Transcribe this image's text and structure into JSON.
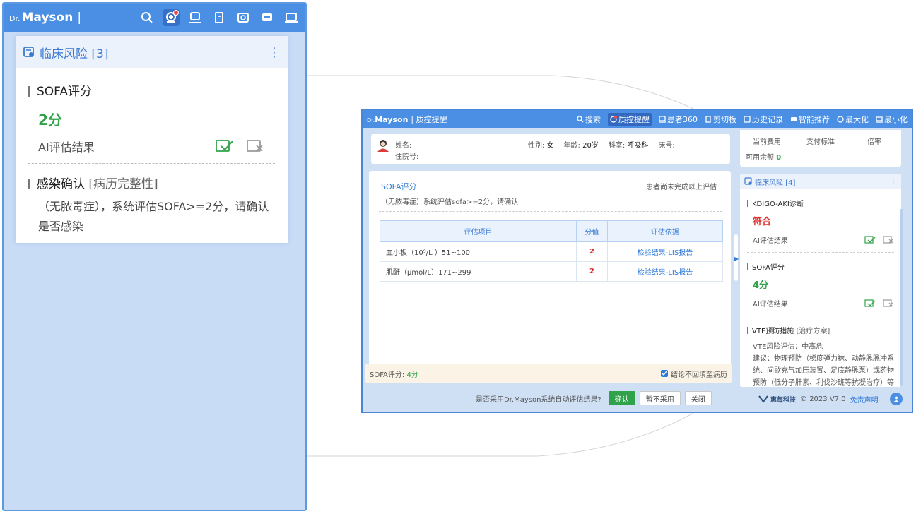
{
  "left_panel": {
    "brand_prefix": "Dr.",
    "brand_name": "Mayson",
    "brand_sep": "|",
    "card": {
      "title": "临床风险 [3]",
      "items": [
        {
          "title": "SOFA评分",
          "score": "2分",
          "ai_label": "AI评估结果"
        },
        {
          "title": "感染确认",
          "tag": "[病历完整性]",
          "desc": "（无脓毒症），系统评估SOFA>=2分，请确认是否感染"
        }
      ]
    }
  },
  "window": {
    "brand_prefix": "Dr.",
    "brand_name": "Mayson",
    "title": "| 质控提醒",
    "nav": [
      "搜索",
      "质控提醒",
      "患者360",
      "剪切板",
      "历史记录",
      "智能推荐",
      "最大化",
      "最小化"
    ],
    "patient": {
      "name_label": "姓名:",
      "gender_label": "性别:",
      "gender": "女",
      "age_label": "年龄:",
      "age": "20岁",
      "dept_label": "科室:",
      "dept": "呼吸科",
      "bed_label": "床号:",
      "admission_label": "住院号:"
    },
    "main": {
      "title": "SOFA评分",
      "status": "患者尚未完成以上评估",
      "desc": "（无脓毒症）系统评估sofa>=2分，请确认",
      "table": {
        "headers": [
          "评估项目",
          "分值",
          "评估依据"
        ],
        "rows": [
          {
            "item": "血小板（10⁹/L ）51~100",
            "score": "2",
            "basis": "检验结果-LIS报告"
          },
          {
            "item": "肌酐（μmol/L）171~299",
            "score": "2",
            "basis": "检验结果-LIS报告"
          }
        ]
      },
      "summary_label": "SOFA评分:",
      "summary_value": "4分",
      "checkbox_label": "结论不回填至病历"
    },
    "footer": {
      "question": "是否采用Dr.Mayson系统自动评估结果?",
      "confirm": "确认",
      "reject": "暂不采用",
      "close": "关闭"
    },
    "fees": {
      "headers": [
        "当前费用",
        "支付标准",
        "倍率"
      ],
      "balance_label": "可用余额",
      "balance": "0"
    },
    "risk_card": {
      "title": "临床风险 [4]",
      "items": [
        {
          "title": "KDIGO-AKI诊断",
          "score": "符合",
          "ai_label": "AI评估结果",
          "color": "#e03030"
        },
        {
          "title": "SOFA评分",
          "score": "4分",
          "ai_label": "AI评估结果",
          "color": "#2fa24a"
        },
        {
          "title": "VTE预防措施",
          "tag": "[治疗方案]",
          "line1": "VTE风险评估：中高危",
          "line2": "建议：物理预防（梯度弹力袜、动静脉脉冲系统、间歇充气加压装置、足底静脉泵）或药物预防（低分子肝素、利伐沙班等抗凝治疗）等预防措施"
        }
      ]
    },
    "copyright": {
      "company": "惠每科技",
      "text": "© 2023 V7.0",
      "disclaimer": "免责声明"
    }
  }
}
